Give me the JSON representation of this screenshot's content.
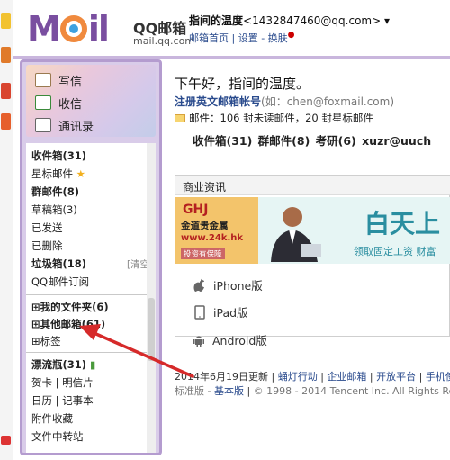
{
  "header": {
    "logo_brand": "QQ邮箱",
    "logo_url": "mail.qq.com",
    "user_name": "指间的温度",
    "user_email": "<1432847460@qq.com>",
    "user_links": [
      "邮箱首页",
      "设置",
      "换肤"
    ]
  },
  "sidebar": {
    "buttons": [
      {
        "label": "写信",
        "icon": "compose-icon"
      },
      {
        "label": "收信",
        "icon": "inbox-download-icon"
      },
      {
        "label": "通讯录",
        "icon": "contacts-icon"
      }
    ],
    "items": [
      {
        "label": "收件箱(31)",
        "bold": true
      },
      {
        "label": "星标邮件",
        "bold": false
      },
      {
        "label": "群邮件(8)",
        "bold": true
      },
      {
        "label": "草稿箱(3)",
        "bold": false
      },
      {
        "label": "已发送",
        "bold": false
      },
      {
        "label": "已删除",
        "bold": false
      },
      {
        "label": "垃圾箱(18)",
        "bold": true
      },
      {
        "label": "QQ邮件订阅",
        "bold": false
      },
      {
        "label": "我的文件夹(6)",
        "bold": true
      },
      {
        "label": "其他邮箱(61)",
        "bold": true
      },
      {
        "label": "标签",
        "bold": false
      },
      {
        "label": "漂流瓶(31)",
        "bold": true
      },
      {
        "label": "贺卡 | 明信片",
        "bold": false
      },
      {
        "label": "日历 | 记事本",
        "bold": false
      },
      {
        "label": "附件收藏",
        "bold": false
      },
      {
        "label": "文件中转站",
        "bold": false
      }
    ],
    "clear_label": "[清空]",
    "expand_glyph": "⊞"
  },
  "main": {
    "greeting": "下午好，指间的温度。",
    "register_text": "注册英文邮箱帐号",
    "register_hint": "(如：chen@foxmail.com)",
    "mail_stat": "邮件：106 封未读邮件，20 封星标邮件",
    "folder_summary": "收件箱(31)  群邮件(8)  考研(6)  xuzr@uuch",
    "news_title": "商业资讯",
    "ad": {
      "logo": "GHJ",
      "brand": "金道贵金属",
      "url": "www.24k.hk",
      "sub": "投资有保障",
      "headline": "白天上",
      "subline": "领取固定工资   财富"
    },
    "apps": [
      "iPhone版",
      "iPad版",
      "Android版"
    ],
    "footer_line1": [
      "2014年6月19日更新",
      "蛹灯行动",
      "企业邮箱",
      "开放平台",
      "手机使"
    ],
    "footer_line2_links": [
      "标准版",
      "基本版"
    ],
    "footer_copyright": "© 1998 - 2014 Tencent Inc. All Rights Re"
  },
  "colors": {
    "brand_purple": "#7a4fa0",
    "sidebar_bg": "#d9cce9",
    "link_blue": "#2a4b8d",
    "arrow_red": "#d62a2a"
  }
}
